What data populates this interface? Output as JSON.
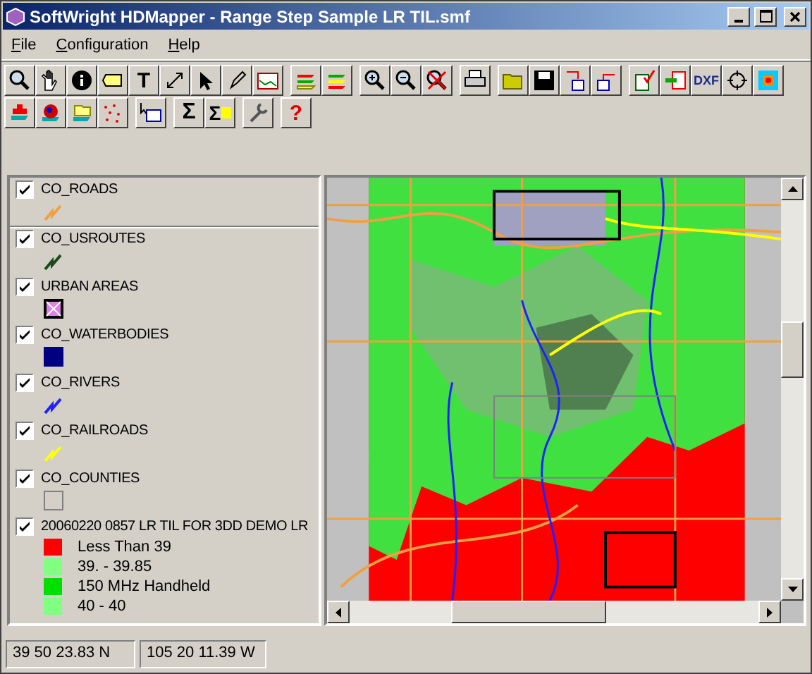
{
  "window": {
    "title": "SoftWright HDMapper - Range Step Sample LR TIL.smf"
  },
  "menu": [
    {
      "label": "File"
    },
    {
      "label": "Configuration"
    },
    {
      "label": "Help"
    }
  ],
  "toolbar": {
    "text_tool": "T",
    "sum": "Σ",
    "sum_selected": "Σ",
    "dxf": "DXF",
    "help": "?"
  },
  "layers": [
    {
      "name": "CO_ROADS",
      "checked": true,
      "kind": "line",
      "color": "#f0a040"
    },
    {
      "name": "CO_USROUTES",
      "checked": true,
      "kind": "line",
      "color": "#1a4a1a"
    },
    {
      "name": "URBAN AREAS",
      "checked": true,
      "kind": "hatch",
      "color": "#e080e0"
    },
    {
      "name": "CO_WATERBODIES",
      "checked": true,
      "kind": "fill",
      "color": "#000080"
    },
    {
      "name": "CO_RIVERS",
      "checked": true,
      "kind": "line",
      "color": "#2020ff"
    },
    {
      "name": "CO_RAILROADS",
      "checked": true,
      "kind": "line",
      "color": "#ffff00"
    },
    {
      "name": "CO_COUNTIES",
      "checked": true,
      "kind": "outline",
      "color": "#808080"
    },
    {
      "name": "20060220 0857 LR TIL FOR 3DD DEMO LR",
      "checked": true,
      "kind": "ranges",
      "ranges": [
        {
          "label": "Less Than 39",
          "color": "#ff0000"
        },
        {
          "label": "39. - 39.85",
          "color": "#80ff80"
        },
        {
          "label": "150 MHz Handheld",
          "color": "#00e000"
        },
        {
          "label": "40 - 40",
          "color": "#80ff80"
        }
      ]
    }
  ],
  "status_bar": [
    "39 50 23.83 N",
    "105 20 11.39 W"
  ]
}
